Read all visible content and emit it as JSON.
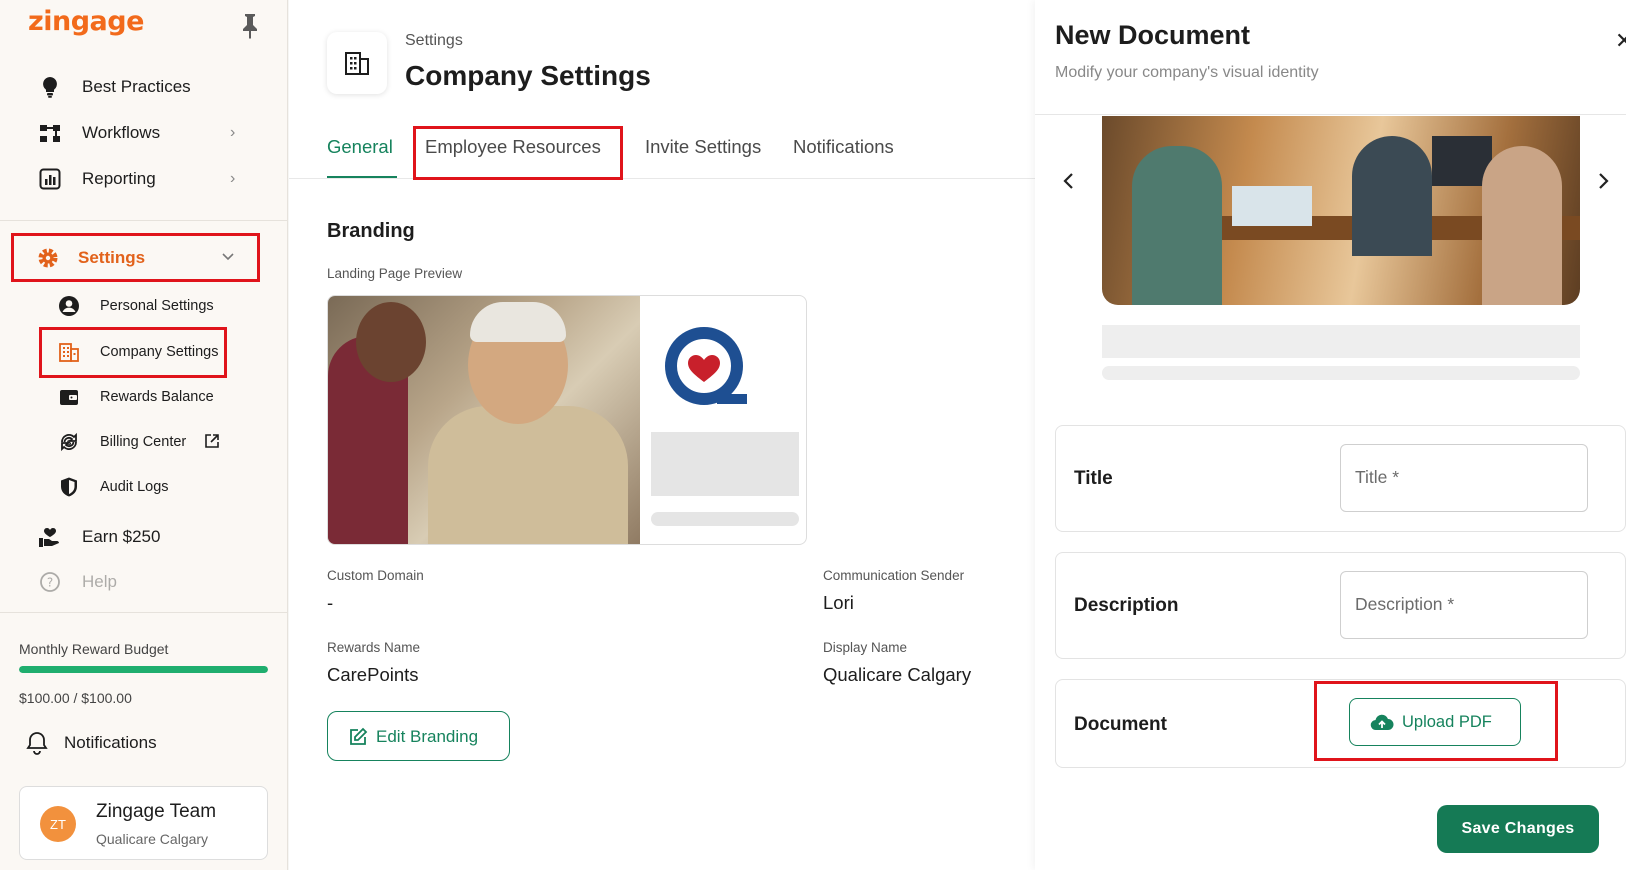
{
  "app": {
    "logo": "zingage"
  },
  "sidebar": {
    "nav": [
      {
        "label": "Best Practices",
        "icon": "lightbulb-icon"
      },
      {
        "label": "Workflows",
        "icon": "workflow-icon"
      },
      {
        "label": "Reporting",
        "icon": "report-icon"
      },
      {
        "label": "Settings",
        "icon": "gear-icon"
      }
    ],
    "settings_sub": [
      {
        "label": "Personal Settings",
        "icon": "user-icon"
      },
      {
        "label": "Company Settings",
        "icon": "building-icon"
      },
      {
        "label": "Rewards Balance",
        "icon": "wallet-icon"
      },
      {
        "label": "Billing Center",
        "icon": "billing-icon"
      },
      {
        "label": "Audit Logs",
        "icon": "shield-icon"
      }
    ],
    "earn": "Earn $250",
    "help": "Help",
    "budget": {
      "title": "Monthly Reward Budget",
      "value": "$100.00 / $100.00",
      "fraction": 1.0
    },
    "notifications": "Notifications",
    "user": {
      "initials": "ZT",
      "name": "Zingage Team",
      "org": "Qualicare Calgary"
    }
  },
  "main": {
    "breadcrumb": "Settings",
    "title": "Company Settings",
    "tabs": [
      "General",
      "Employee Resources",
      "Invite Settings",
      "Notifications"
    ],
    "active_tab": "General",
    "section": "Branding",
    "preview_label": "Landing Page Preview",
    "fields": {
      "custom_domain": {
        "label": "Custom Domain",
        "value": "-"
      },
      "communication_sender": {
        "label": "Communication Sender",
        "value": "Lori"
      },
      "rewards_name": {
        "label": "Rewards Name",
        "value": "CarePoints"
      },
      "display_name": {
        "label": "Display Name",
        "value": "Qualicare Calgary"
      }
    },
    "edit_button": "Edit Branding"
  },
  "drawer": {
    "title": "New Document",
    "subtitle": "Modify your company's visual identity",
    "title_row": {
      "label": "Title",
      "placeholder": "Title *"
    },
    "description_row": {
      "label": "Description",
      "placeholder": "Description *"
    },
    "document_row": {
      "label": "Document",
      "button": "Upload PDF"
    },
    "save": "Save Changes"
  },
  "colors": {
    "brand": "#f26a1b",
    "primary": "#16835d",
    "highlight": "#e0141b"
  }
}
